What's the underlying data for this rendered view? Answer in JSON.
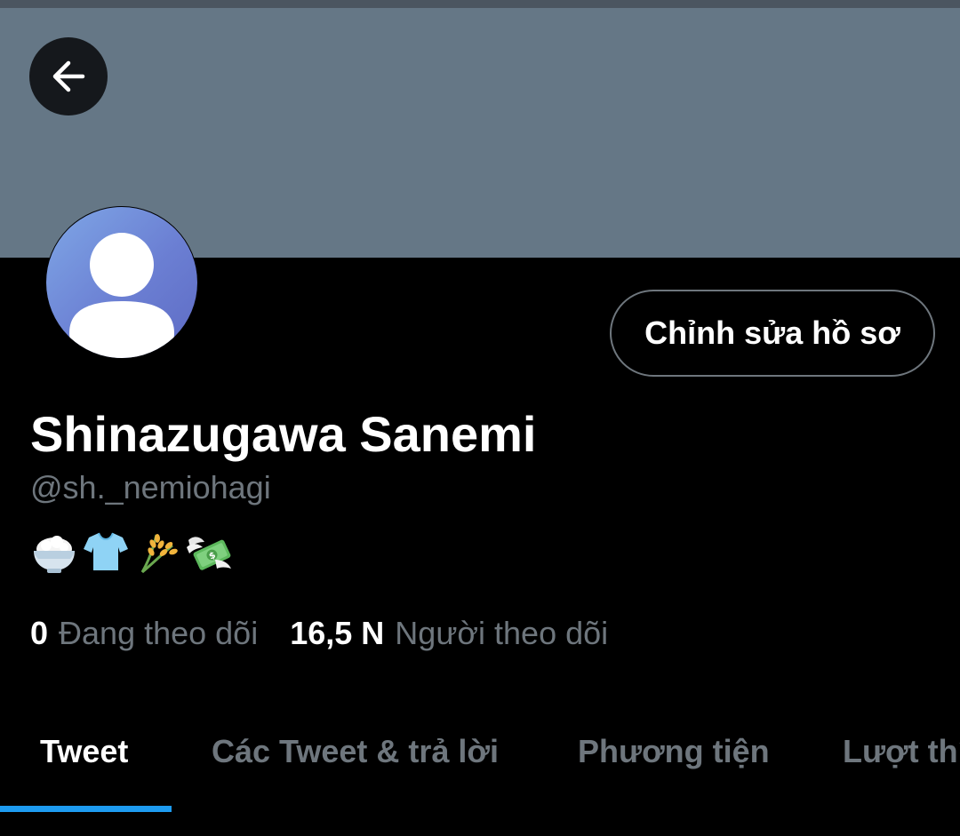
{
  "header": {
    "back_icon": "arrow-left-icon",
    "banner_color": "#657786"
  },
  "profile": {
    "avatar_icon": "default-avatar-icon",
    "edit_button_label": "Chỉnh sửa hồ sơ",
    "display_name": "Shinazugawa Sanemi",
    "handle": "@sh._nemiohagi",
    "bio_icons": [
      "rice-bowl-icon",
      "t-shirt-icon",
      "rice-sheaf-icon",
      "money-with-wings-icon"
    ]
  },
  "stats": {
    "following_count": "0",
    "following_label": "Đang theo dõi",
    "followers_count": "16,5 N",
    "followers_label": "Người theo dõi"
  },
  "tabs": [
    {
      "label": "Tweet",
      "active": true
    },
    {
      "label": "Các Tweet & trả lời",
      "active": false
    },
    {
      "label": "Phương tiện",
      "active": false
    },
    {
      "label": "Lượt thích",
      "active": false
    }
  ],
  "colors": {
    "background": "#000000",
    "accent": "#1d9bf0",
    "muted_text": "#6e767d"
  }
}
